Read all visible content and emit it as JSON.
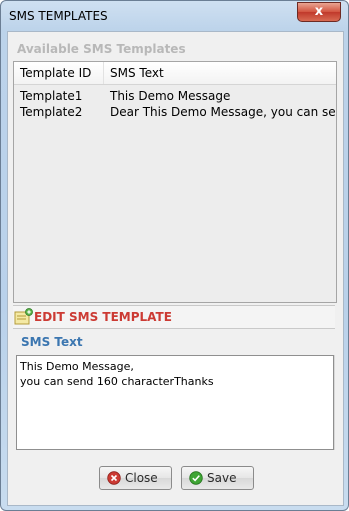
{
  "window": {
    "title": "SMS TEMPLATES",
    "close_glyph": "x"
  },
  "templates": {
    "heading": "Available SMS Templates",
    "columns": [
      "Template ID",
      "SMS Text"
    ],
    "rows": [
      {
        "id": "Template1",
        "text": "This Demo Message"
      },
      {
        "id": "Template2",
        "text": "Dear  This Demo Message, you can send"
      }
    ]
  },
  "editor": {
    "heading": "EDIT SMS TEMPLATE",
    "field_label": "SMS Text",
    "field_value": "This Demo Message,\nyou can send 160 characterThanks"
  },
  "buttons": {
    "close_label": "Close",
    "save_label": "Save"
  },
  "colors": {
    "edit_heading": "#cc3a33",
    "field_label": "#3b76b0",
    "close_icon": "#cc3a33",
    "save_icon": "#3fa535"
  },
  "icons": {
    "edit": "note-pencil-icon",
    "close": "cancel-icon",
    "save": "check-icon"
  }
}
